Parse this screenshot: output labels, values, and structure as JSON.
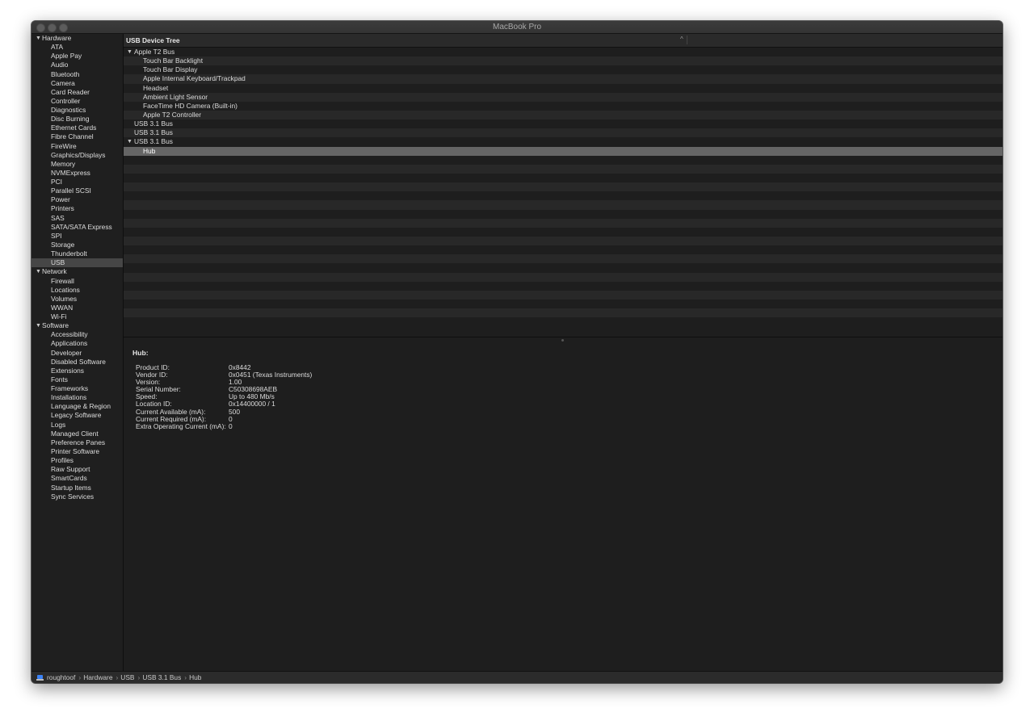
{
  "window": {
    "title": "MacBook Pro"
  },
  "sidebar": {
    "groups": [
      {
        "label": "Hardware",
        "items": [
          "ATA",
          "Apple Pay",
          "Audio",
          "Bluetooth",
          "Camera",
          "Card Reader",
          "Controller",
          "Diagnostics",
          "Disc Burning",
          "Ethernet Cards",
          "Fibre Channel",
          "FireWire",
          "Graphics/Displays",
          "Memory",
          "NVMExpress",
          "PCI",
          "Parallel SCSI",
          "Power",
          "Printers",
          "SAS",
          "SATA/SATA Express",
          "SPI",
          "Storage",
          "Thunderbolt",
          "USB"
        ]
      },
      {
        "label": "Network",
        "items": [
          "Firewall",
          "Locations",
          "Volumes",
          "WWAN",
          "Wi-Fi"
        ]
      },
      {
        "label": "Software",
        "items": [
          "Accessibility",
          "Applications",
          "Developer",
          "Disabled Software",
          "Extensions",
          "Fonts",
          "Frameworks",
          "Installations",
          "Language & Region",
          "Legacy Software",
          "Logs",
          "Managed Client",
          "Preference Panes",
          "Printer Software",
          "Profiles",
          "Raw Support",
          "SmartCards",
          "Startup Items",
          "Sync Services"
        ]
      }
    ],
    "selected": "USB"
  },
  "tree": {
    "header": "USB Device Tree",
    "sort_indicator": "^",
    "rows": [
      {
        "label": "Apple T2 Bus",
        "level": 0,
        "expanded": true
      },
      {
        "label": "Touch Bar Backlight",
        "level": 1
      },
      {
        "label": "Touch Bar Display",
        "level": 1
      },
      {
        "label": "Apple Internal Keyboard/Trackpad",
        "level": 1
      },
      {
        "label": "Headset",
        "level": 1
      },
      {
        "label": "Ambient Light Sensor",
        "level": 1
      },
      {
        "label": "FaceTime HD Camera (Built-in)",
        "level": 1
      },
      {
        "label": "Apple T2 Controller",
        "level": 1
      },
      {
        "label": "USB 3.1 Bus",
        "level": 0
      },
      {
        "label": "USB 3.1 Bus",
        "level": 0
      },
      {
        "label": "USB 3.1 Bus",
        "level": 0,
        "expanded": true
      },
      {
        "label": "Hub",
        "level": 1,
        "selected": true
      }
    ]
  },
  "detail": {
    "title": "Hub:",
    "fields": [
      {
        "key": "Product ID:",
        "value": "0x8442"
      },
      {
        "key": "Vendor ID:",
        "value": "0x0451  (Texas Instruments)"
      },
      {
        "key": "Version:",
        "value": "1.00"
      },
      {
        "key": "Serial Number:",
        "value": "C50308698AEB"
      },
      {
        "key": "Speed:",
        "value": "Up to 480 Mb/s"
      },
      {
        "key": "Location ID:",
        "value": "0x14400000 / 1"
      },
      {
        "key": "Current Available (mA):",
        "value": "500"
      },
      {
        "key": "Current Required (mA):",
        "value": "0"
      },
      {
        "key": "Extra Operating Current (mA):",
        "value": "0"
      }
    ]
  },
  "statusbar": {
    "icon": "laptop-icon",
    "breadcrumbs": [
      "roughtoof",
      "Hardware",
      "USB",
      "USB 3.1 Bus",
      "Hub"
    ]
  },
  "colors": {
    "selection_sidebar": "#464646",
    "selection_row": "#656565",
    "accent_icon": "#3b82f6"
  }
}
